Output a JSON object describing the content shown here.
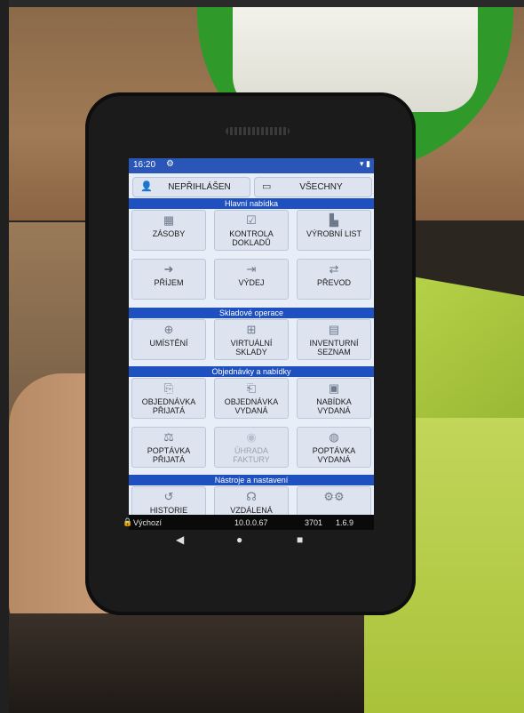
{
  "statusbar": {
    "time": "16:20",
    "settings_icon": "gear-icon",
    "status_icons": "wifi battery"
  },
  "header": {
    "user_label": "NEPŘIHLÁŠEN",
    "user_icon": "user-icon",
    "warehouse_label": "VŠECHNY",
    "warehouse_icon": "warehouse-icon"
  },
  "sections": {
    "main": "Hlavní nabídka",
    "stock_ops": "Skladové operace",
    "orders": "Objednávky a nabídky",
    "tools": "Nástroje a nastavení"
  },
  "tiles": {
    "zasoby": {
      "label": "ZÁSOBY",
      "icon": "boxes-icon"
    },
    "kontrola": {
      "label1": "KONTROLA",
      "label2": "DOKLADŮ",
      "icon": "clipboard-check-icon"
    },
    "vyrobni": {
      "label": "VÝROBNÍ LIST",
      "icon": "factory-icon"
    },
    "prijem": {
      "label": "PŘÍJEM",
      "icon": "sign-in-icon"
    },
    "vydej": {
      "label": "VÝDEJ",
      "icon": "sign-out-icon"
    },
    "prevod": {
      "label": "PŘEVOD",
      "icon": "exchange-icon"
    },
    "umisteni": {
      "label": "UMÍSTĚNÍ",
      "icon": "crosshair-icon"
    },
    "virtualni": {
      "label1": "VIRTUÁLNÍ",
      "label2": "SKLADY",
      "icon": "grid-icon"
    },
    "inventurni": {
      "label1": "INVENTURNÍ",
      "label2": "SEZNAM",
      "icon": "clipboard-list-icon"
    },
    "obj_prijata": {
      "label1": "OBJEDNÁVKA",
      "label2": "PŘIJATÁ",
      "icon": "file-import-icon"
    },
    "obj_vydana": {
      "label1": "OBJEDNÁVKA",
      "label2": "VYDANÁ",
      "icon": "file-export-icon"
    },
    "nab_vydana": {
      "label1": "NABÍDKA",
      "label2": "VYDANÁ",
      "icon": "file-invoice-icon"
    },
    "popt_prijata": {
      "label1": "POPTÁVKA",
      "label2": "PŘIJATÁ",
      "icon": "balance-scale-icon"
    },
    "uhrada": {
      "label1": "ÚHRADA",
      "label2": "FAKTURY",
      "icon": "coins-icon",
      "disabled": true
    },
    "popt_vydana": {
      "label1": "POPTÁVKA",
      "label2": "VYDANÁ",
      "icon": "handshake-icon"
    },
    "historie": {
      "label": "HISTORIE",
      "icon": "history-icon"
    },
    "vzdalena": {
      "label": "VZDÁLENÁ",
      "icon": "headset-icon"
    },
    "nastaveni": {
      "label": "",
      "icon": "cogs-icon"
    }
  },
  "footer": {
    "location": "Výchozí",
    "ip": "10.0.0.67",
    "port": "3701",
    "version": "1.6.9"
  },
  "nav": {
    "back": "◀",
    "home": "●",
    "recent": "■"
  },
  "colors": {
    "accent": "#1e50c0",
    "tile_bg": "#dde4f0",
    "screen_bg": "#e8eef7"
  }
}
